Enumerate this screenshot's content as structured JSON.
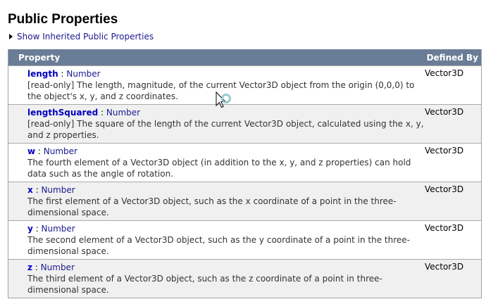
{
  "title": "Public Properties",
  "inherited_link": "Show Inherited Public Properties",
  "table": {
    "headers": {
      "property": "Property",
      "defined_by": "Defined By"
    },
    "rows": [
      {
        "name": "length",
        "type": "Number",
        "description": "[read-only] The length, magnitude, of the current Vector3D object from the origin (0,0,0) to the object's x, y, and z coordinates.",
        "defined_by": "Vector3D"
      },
      {
        "name": "lengthSquared",
        "type": "Number",
        "description": "[read-only] The square of the length of the current Vector3D object, calculated using the x, y, and z properties.",
        "defined_by": "Vector3D"
      },
      {
        "name": "w",
        "type": "Number",
        "description": "The fourth element of a Vector3D object (in addition to the x, y, and z properties) can hold data such as the angle of rotation.",
        "defined_by": "Vector3D"
      },
      {
        "name": "x",
        "type": "Number",
        "description": "The first element of a Vector3D object, such as the x coordinate of a point in the three-dimensional space.",
        "defined_by": "Vector3D"
      },
      {
        "name": "y",
        "type": "Number",
        "description": "The second element of a Vector3D object, such as the y coordinate of a point in the three-dimensional space.",
        "defined_by": "Vector3D"
      },
      {
        "name": "z",
        "type": "Number",
        "description": "The third element of a Vector3D object, such as the z coordinate of a point in three-dimensional space.",
        "defined_by": "Vector3D"
      }
    ]
  }
}
